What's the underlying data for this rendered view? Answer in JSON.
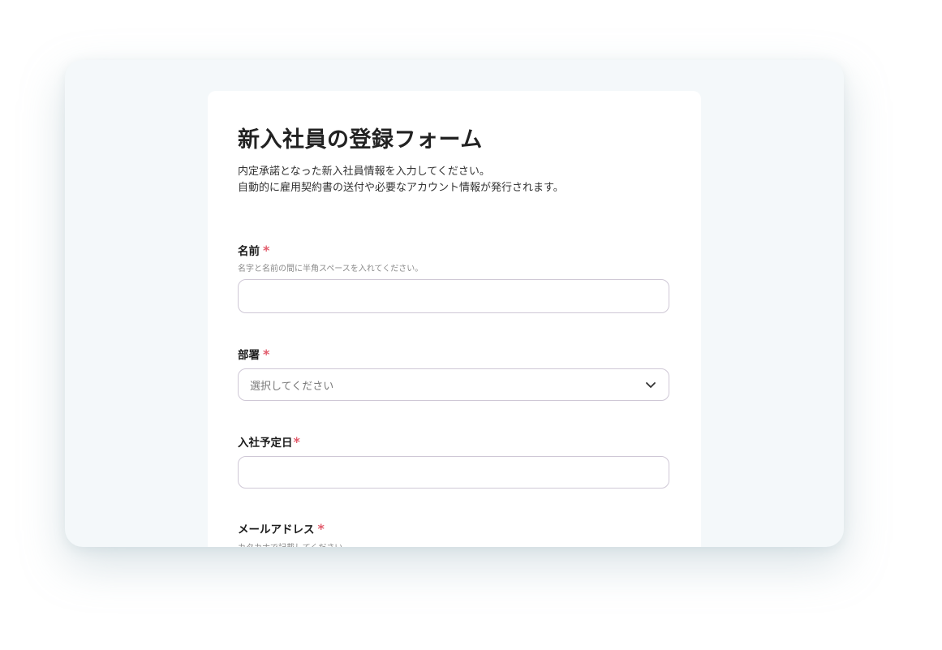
{
  "form": {
    "title": "新入社員の登録フォーム",
    "description": [
      "内定承諾となった新入社員情報を入力してください。",
      "自動的に雇用契約書の送付や必要なアカウント情報が発行されます。"
    ],
    "required_mark": "*",
    "fields": {
      "name": {
        "label": "名前",
        "hint": "名字と名前の間に半角スペースを入れてください。",
        "value": ""
      },
      "department": {
        "label": "部署",
        "placeholder": "選択してください"
      },
      "start_date": {
        "label": "入社予定日",
        "value": ""
      },
      "email": {
        "label": "メールアドレス",
        "hint": "カタカナで記載してください。"
      }
    }
  },
  "colors": {
    "required": "#e25b6b",
    "frame_bg": "#f4f8fa",
    "input_border": "#cfc8d6"
  },
  "icons": {
    "select_chevron": "chevron-down-icon"
  }
}
